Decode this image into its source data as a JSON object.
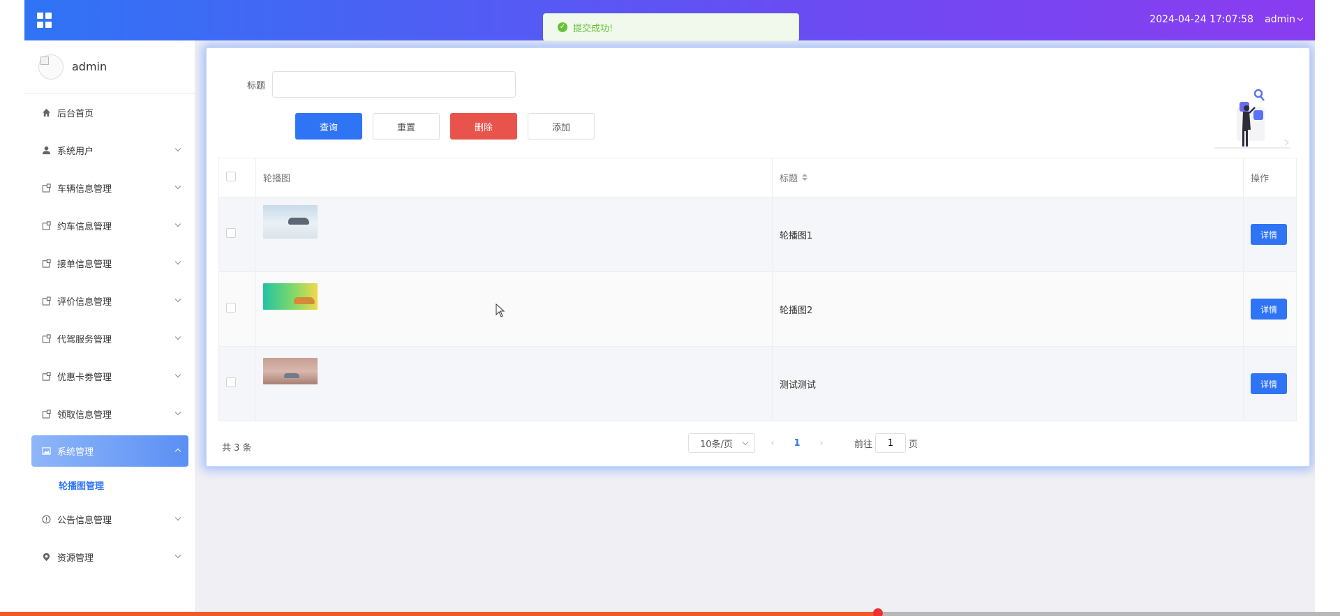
{
  "header": {
    "datetime": "2024-04-24 17:07:58",
    "user": "admin"
  },
  "toast": {
    "message": "提交成功!"
  },
  "sidebar": {
    "profile_name": "admin",
    "items": [
      {
        "label": "后台首页",
        "icon": "home-icon"
      },
      {
        "label": "系统用户",
        "icon": "user-icon"
      },
      {
        "label": "车辆信息管理",
        "icon": "module-icon"
      },
      {
        "label": "约车信息管理",
        "icon": "module-icon"
      },
      {
        "label": "接单信息管理",
        "icon": "module-icon"
      },
      {
        "label": "评价信息管理",
        "icon": "module-icon"
      },
      {
        "label": "代驾服务管理",
        "icon": "module-icon"
      },
      {
        "label": "优惠卡劵管理",
        "icon": "module-icon"
      },
      {
        "label": "领取信息管理",
        "icon": "module-icon"
      },
      {
        "label": "系统管理",
        "icon": "image-icon"
      },
      {
        "label": "公告信息管理",
        "icon": "info-icon"
      },
      {
        "label": "资源管理",
        "icon": "location-icon"
      }
    ],
    "sub_item": "轮播图管理"
  },
  "search": {
    "label": "标题",
    "value": "",
    "placeholder": ""
  },
  "actions": {
    "query": "查询",
    "reset": "重置",
    "delete": "删除",
    "add": "添加"
  },
  "table": {
    "columns": [
      "轮播图",
      "标题",
      "操作"
    ],
    "rows": [
      {
        "title": "轮播图1",
        "action": "详情"
      },
      {
        "title": "轮播图2",
        "action": "详情"
      },
      {
        "title": "测试测试",
        "action": "详情"
      }
    ]
  },
  "pagination": {
    "total": "共 3 条",
    "page_size": "10条/页",
    "current_page": "1",
    "goto_label": "前往",
    "goto_value": "1",
    "page_suffix": "页"
  },
  "colors": {
    "primary": "#2f74f5",
    "danger": "#e8534c",
    "success": "#67c23a"
  },
  "video_progress": 0.655
}
